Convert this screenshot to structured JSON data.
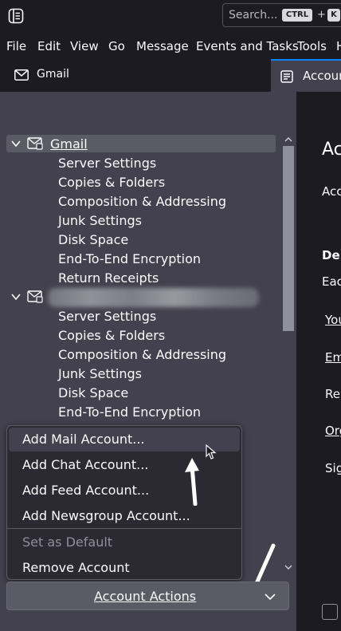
{
  "search": {
    "placeholder": "Search...",
    "shortcut_mod": "CTRL",
    "shortcut_plus": "+",
    "shortcut_key": "K"
  },
  "menubar": [
    "File",
    "Edit",
    "View",
    "Go",
    "Message",
    "Events and Tasks",
    "Tools",
    "H"
  ],
  "tabs": [
    {
      "label": "Gmail",
      "icon": "mail-icon"
    },
    {
      "label": "Accoun",
      "icon": "settings-tab-icon"
    }
  ],
  "tree": {
    "account1": {
      "name": "Gmail",
      "children": [
        "Server Settings",
        "Copies & Folders",
        "Composition & Addressing",
        "Junk Settings",
        "Disk Space",
        "End-To-End Encryption",
        "Return Receipts"
      ]
    },
    "account2": {
      "name": "",
      "children": [
        "Server Settings",
        "Copies & Folders",
        "Composition & Addressing",
        "Junk Settings",
        "Disk Space",
        "End-To-End Encryption"
      ]
    }
  },
  "popup": {
    "items": [
      "Add Mail Account...",
      "Add Chat Account...",
      "Add Feed Account...",
      "Add Newsgroup Account..."
    ],
    "set_default": "Set as Default",
    "remove": "Remove Account"
  },
  "actions_button": "Account Actions",
  "content": {
    "heading": "Ac",
    "sub": "Acc",
    "section": "De",
    "desc": "Eac",
    "field1": "You",
    "field2": "Em",
    "field3": "Rep",
    "field4": "Org",
    "field5": "Sig"
  },
  "colors": {
    "accent": "#0a84ff",
    "pane": "#42414d",
    "bg": "#1c1b22"
  }
}
